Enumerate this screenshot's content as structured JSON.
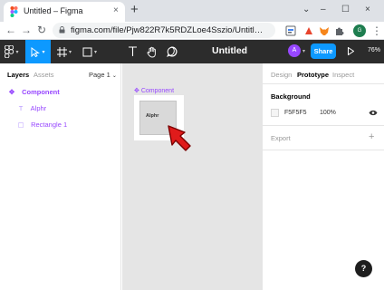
{
  "browser": {
    "tab_title": "Untitled – Figma",
    "tab_close": "×",
    "new_tab": "+",
    "window_controls": {
      "collapse": "⌄",
      "minimize": "–",
      "maximize": "☐",
      "close": "×"
    },
    "nav": {
      "back": "←",
      "forward": "→",
      "reload": "↻"
    },
    "url": "figma.com/file/Pjw822R7k5RDZLoe4Sszio/Untitl…",
    "profile_initial": "G",
    "menu": "⋮",
    "extension_icons": [
      "translate-icon",
      "extension-red-icon",
      "metamask-icon",
      "flag-icon",
      "puzzle-icon",
      "sidepanel-icon"
    ]
  },
  "figma_toolbar": {
    "document_title": "Untitled",
    "document_caret": "⌄",
    "user_initial": "A",
    "share_label": "Share",
    "zoom": "76%",
    "tools": [
      "main-menu",
      "move",
      "frame",
      "shape",
      "text",
      "hand",
      "comment"
    ],
    "active_tool": "move",
    "accent_color": "#0d99ff"
  },
  "left_panel": {
    "tabs": [
      "Layers",
      "Assets"
    ],
    "active_tab": "Layers",
    "page_selector": "Page 1",
    "page_caret": "⌄",
    "layers": [
      {
        "icon": "✥",
        "label": "Component",
        "kind": "component"
      },
      {
        "icon": "T",
        "label": "Alphr",
        "kind": "text"
      },
      {
        "icon": "▢",
        "label": "Rectangle 1",
        "kind": "rectangle"
      }
    ],
    "component_color": "#9747ff"
  },
  "canvas": {
    "frame_label": "Component",
    "frame_label_icon": "✥",
    "rect_text": "Alphr",
    "background": "#e5e5e5"
  },
  "right_panel": {
    "tabs": [
      "Design",
      "Prototype",
      "Inspect"
    ],
    "active_tab": "Prototype",
    "background_title": "Background",
    "background_hex": "F5F5F5",
    "background_opacity": "100%",
    "export_title": "Export",
    "export_add": "+",
    "help_label": "?"
  }
}
